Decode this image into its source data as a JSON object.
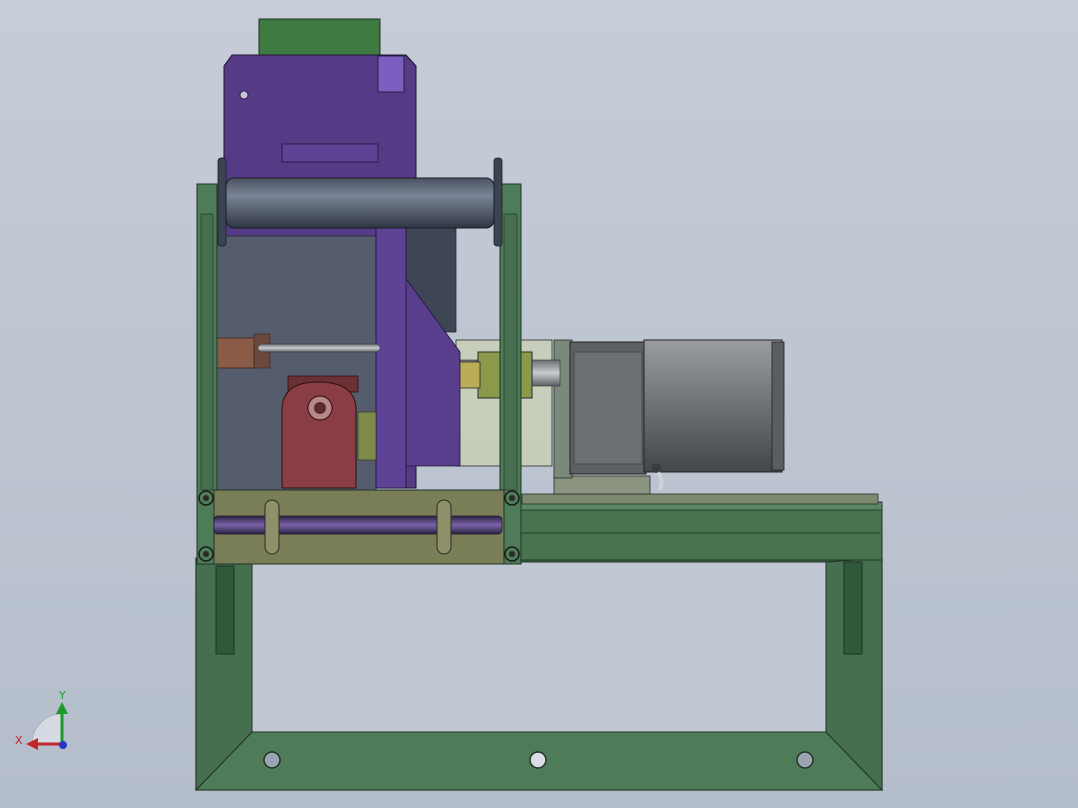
{
  "axis_triad": {
    "x_label": "X",
    "y_label": "Y",
    "x_color": "#c0282a",
    "y_color": "#1f9a2a",
    "z_color": "#2437c8"
  },
  "colors": {
    "frame_green": "#4d7a56",
    "frame_green_dark": "#2f5a3a",
    "housing_purple": "#5b3f8c",
    "bracket_red": "#8a3d42",
    "motor_gray": "#6b6e72",
    "background": "#c6cdd8"
  }
}
